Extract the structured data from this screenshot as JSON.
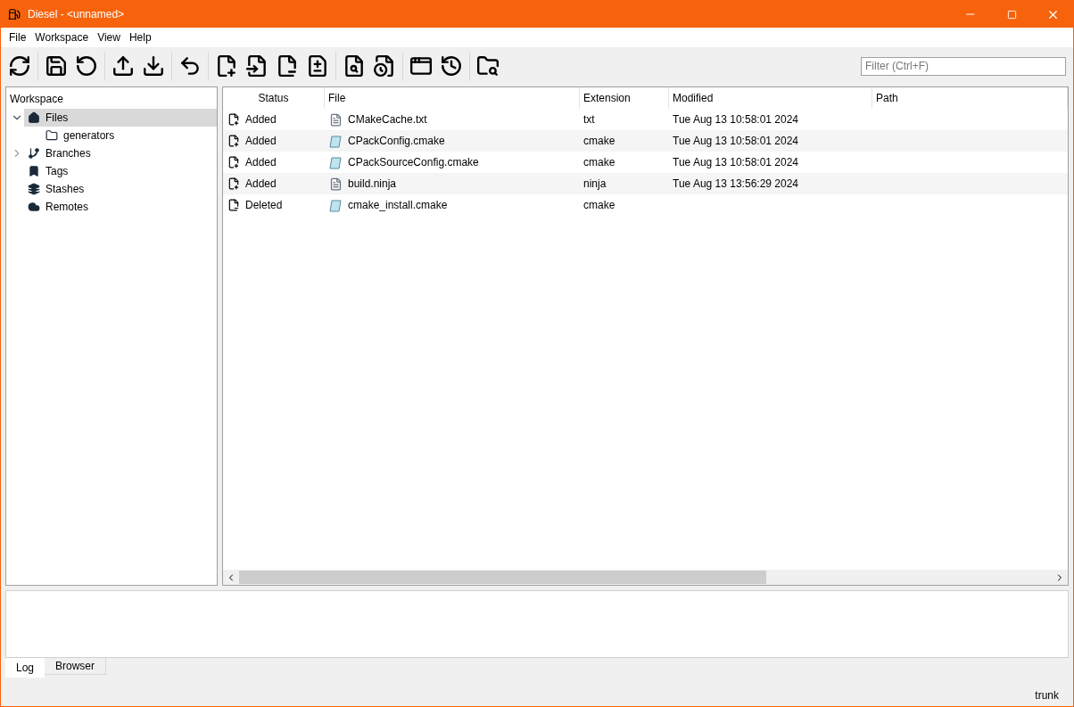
{
  "window": {
    "title": "Diesel - <unnamed>"
  },
  "menu": [
    "File",
    "Workspace",
    "View",
    "Help"
  ],
  "filter": {
    "placeholder": "Filter (Ctrl+F)"
  },
  "sidebar": {
    "title": "Workspace",
    "items": [
      {
        "label": "Files",
        "kind": "home",
        "expanded": true,
        "selected": true,
        "children": [
          {
            "label": "generators",
            "kind": "folder",
            "selected": false
          }
        ]
      },
      {
        "label": "Branches",
        "kind": "branch",
        "expanded": false,
        "selected": false
      },
      {
        "label": "Tags",
        "kind": "tag",
        "selected": false
      },
      {
        "label": "Stashes",
        "kind": "layers",
        "selected": false
      },
      {
        "label": "Remotes",
        "kind": "cloud",
        "selected": false
      }
    ]
  },
  "table": {
    "columns": [
      "Status",
      "File",
      "Extension",
      "Modified",
      "Path"
    ],
    "rows": [
      {
        "status": "Added",
        "kind": "added",
        "file": {
          "name": "CMakeCache.txt",
          "kind": "text"
        },
        "extension": "txt",
        "modified": "Tue Aug 13 10:58:01 2024"
      },
      {
        "status": "Added",
        "kind": "added",
        "file": {
          "name": "CPackConfig.cmake",
          "kind": "cmake"
        },
        "extension": "cmake",
        "modified": "Tue Aug 13 10:58:01 2024"
      },
      {
        "status": "Added",
        "kind": "added",
        "file": {
          "name": "CPackSourceConfig.cmake",
          "kind": "cmake"
        },
        "extension": "cmake",
        "modified": "Tue Aug 13 10:58:01 2024"
      },
      {
        "status": "Added",
        "kind": "added",
        "file": {
          "name": "build.ninja",
          "kind": "text"
        },
        "extension": "ninja",
        "modified": "Tue Aug 13 13:56:29 2024"
      },
      {
        "status": "Deleted",
        "kind": "deleted",
        "file": {
          "name": "cmake_install.cmake",
          "kind": "cmake"
        },
        "extension": "cmake"
      }
    ]
  },
  "bottom_tabs": [
    {
      "label": "Log",
      "selected": true
    },
    {
      "label": "Browser",
      "selected": false
    }
  ],
  "status_bar": {
    "branch": "trunk"
  }
}
